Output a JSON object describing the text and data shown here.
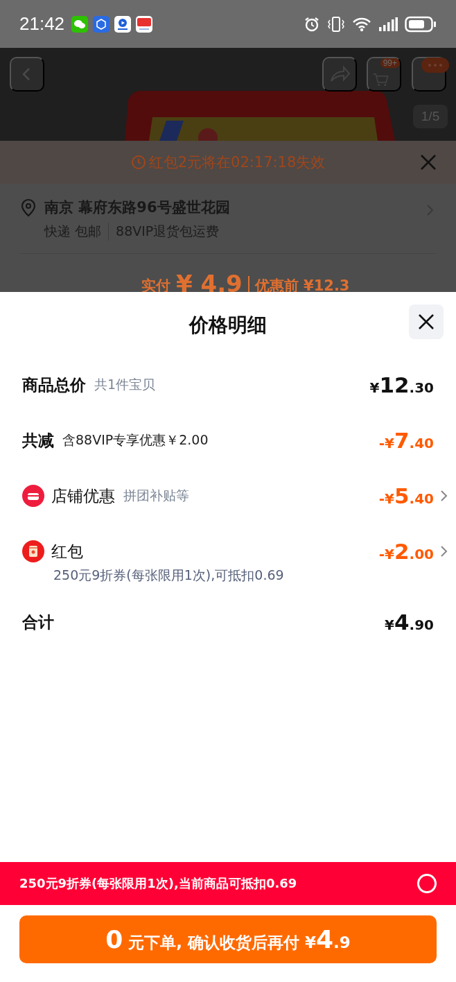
{
  "status_bar": {
    "time": "21:42"
  },
  "product_header": {
    "cart_badge": "99+",
    "image_counter": "1/5"
  },
  "order_sheet": {
    "notice": "红包2元将在02:17:18失效",
    "address": "南京 幕府东路96号盛世花园",
    "shipping": [
      "快递 包邮",
      "88VIP退货包运费"
    ],
    "pay_label": "实付",
    "pay_amount": "¥ 4.9",
    "original_price": "优惠前 ¥12.3"
  },
  "price_details": {
    "title": "价格明细",
    "rows": [
      {
        "kind": "plain",
        "label": "商品总价",
        "note": "共1件宝贝",
        "discount": false,
        "chevron": false,
        "amount": {
          "prefix": "¥",
          "integer": "12",
          "fraction": ".30"
        }
      },
      {
        "kind": "plain",
        "label": "共减",
        "note": "含88VIP专享优惠￥2.00",
        "discount": true,
        "chevron": false,
        "amount": {
          "prefix": "-¥",
          "integer": "7",
          "fraction": ".40"
        }
      },
      {
        "kind": "store",
        "label": "店铺优惠",
        "note": "拼团补贴等",
        "discount": true,
        "chevron": true,
        "amount": {
          "prefix": "-¥",
          "integer": "5",
          "fraction": ".40"
        }
      },
      {
        "kind": "red_packet",
        "label": "红包",
        "detail": "250元9折券(每张限用1次),可抵扣0.69",
        "discount": true,
        "chevron": true,
        "amount": {
          "prefix": "-¥",
          "integer": "2",
          "fraction": ".00"
        }
      },
      {
        "kind": "plain",
        "label": "合计",
        "discount": false,
        "chevron": false,
        "amount": {
          "prefix": "¥",
          "integer": "4",
          "fraction": ".90"
        }
      }
    ]
  },
  "coupon_bar": {
    "text": "250元9折券(每张限用1次),当前商品可抵扣0.69",
    "checked": false
  },
  "order_button": {
    "parts": [
      {
        "text": "0",
        "big": true
      },
      {
        "text": " 元下单, 确认收货后再付 ¥",
        "big": false
      },
      {
        "text": "4",
        "big": true
      },
      {
        "text": ".9",
        "big": false
      }
    ]
  }
}
